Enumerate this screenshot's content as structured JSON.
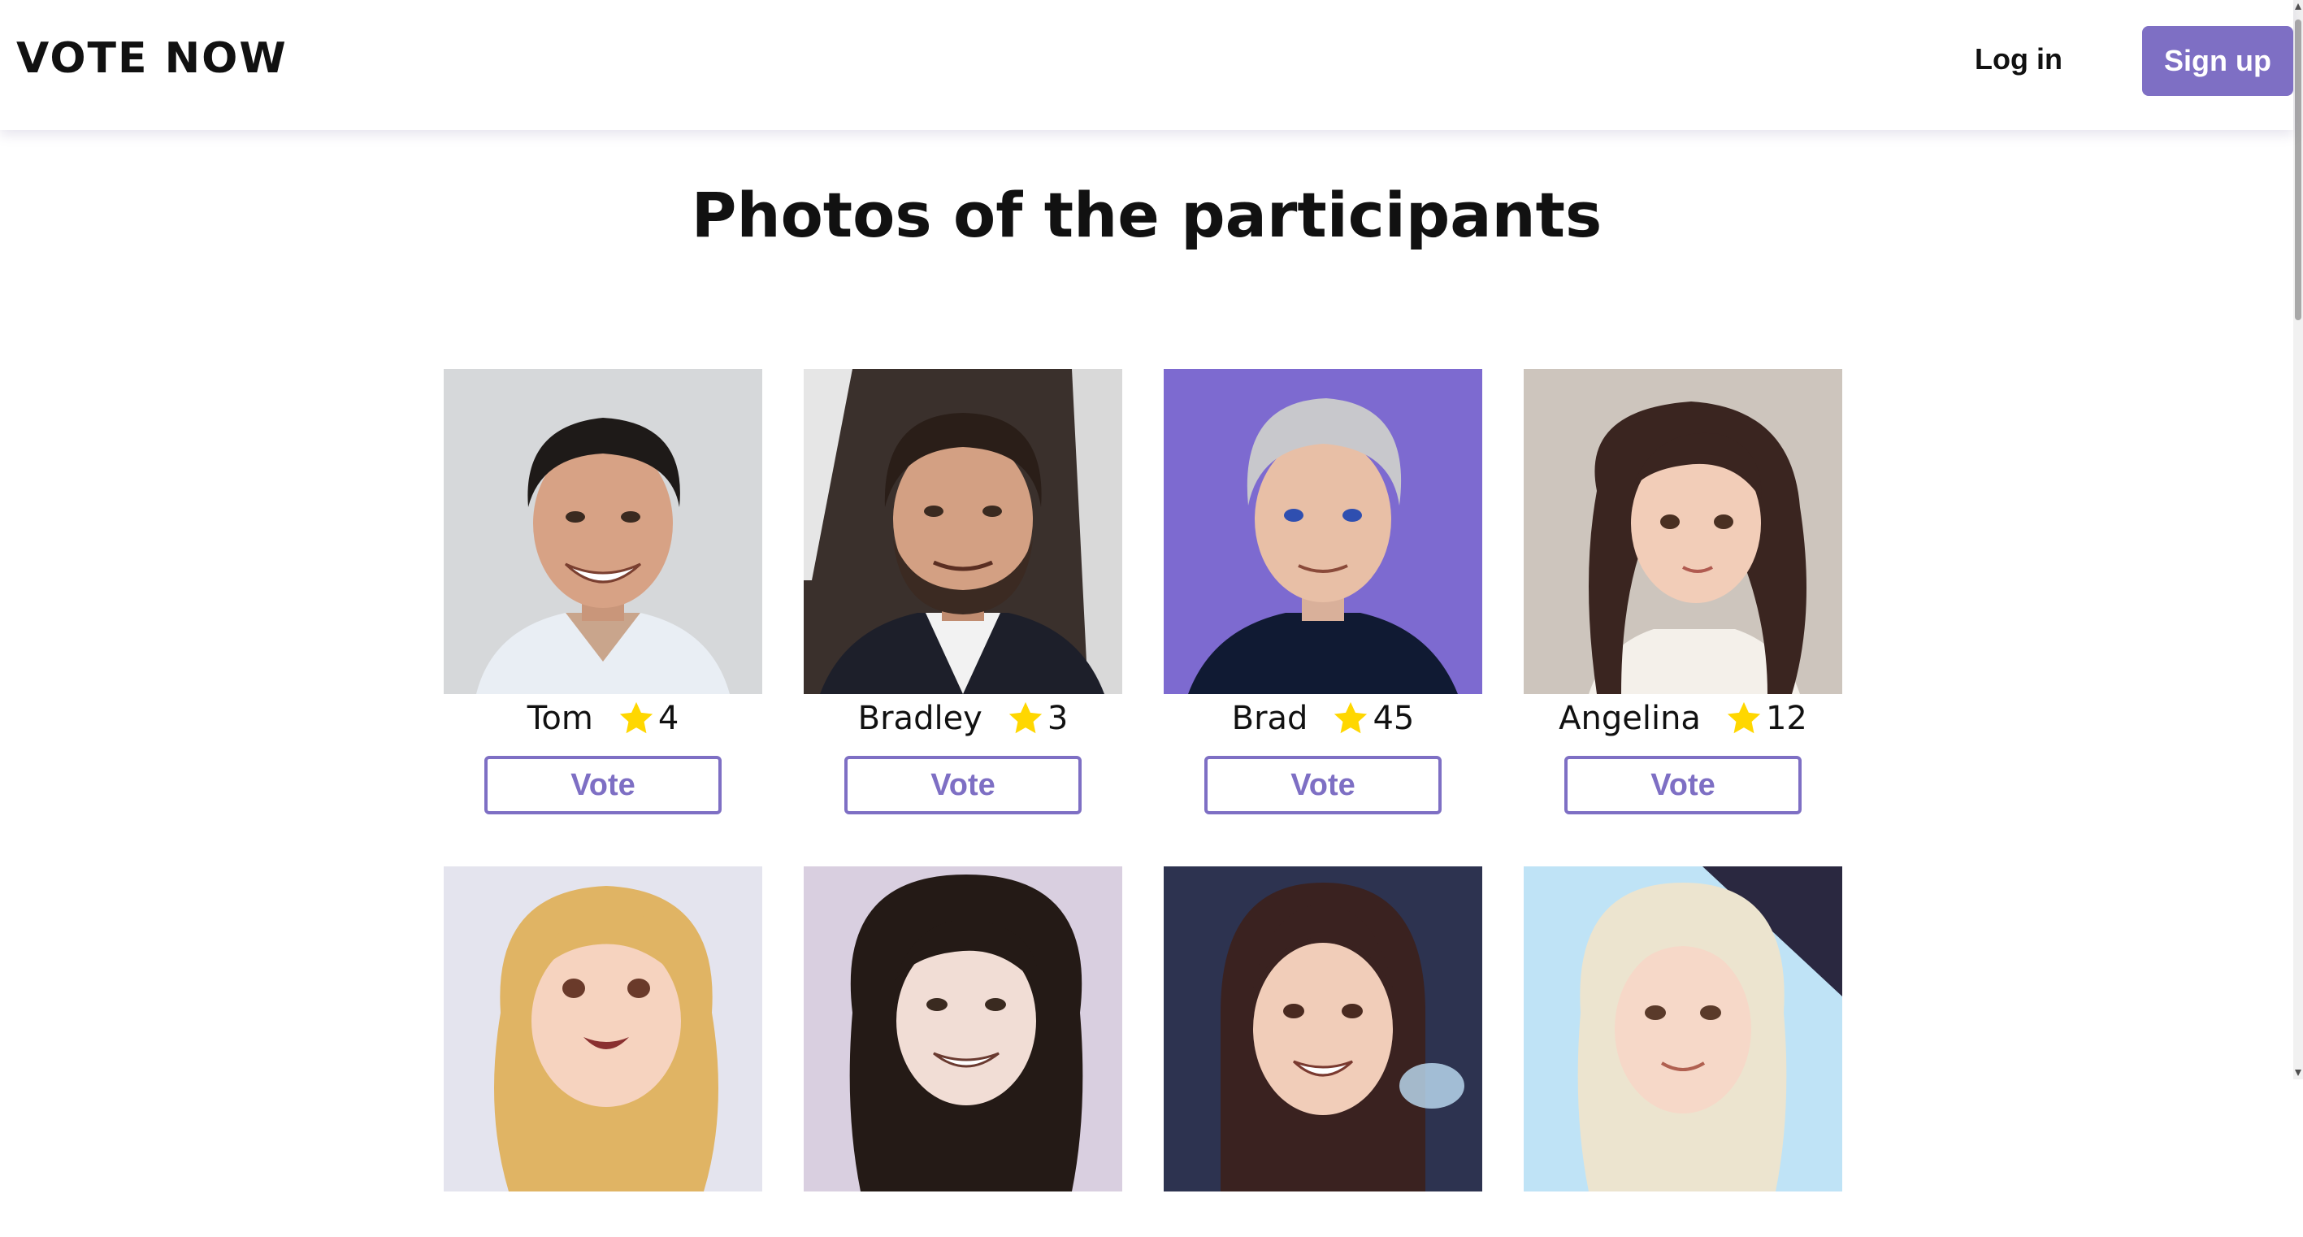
{
  "header": {
    "logo": "VOTE NOW",
    "login_label": "Log in",
    "signup_label": "Sign up"
  },
  "main": {
    "title": "Photos of the participants",
    "vote_label": "Vote",
    "participants": [
      {
        "name": "Tom",
        "votes": "4"
      },
      {
        "name": "Bradley",
        "votes": "3"
      },
      {
        "name": "Brad",
        "votes": "45"
      },
      {
        "name": "Angelina",
        "votes": "12"
      },
      {
        "name": "",
        "votes": ""
      },
      {
        "name": "",
        "votes": ""
      },
      {
        "name": "",
        "votes": ""
      },
      {
        "name": "",
        "votes": ""
      }
    ]
  },
  "colors": {
    "accent": "#7e6fc4",
    "star": "#ffd700"
  },
  "icons": {
    "rating": "star-icon"
  }
}
